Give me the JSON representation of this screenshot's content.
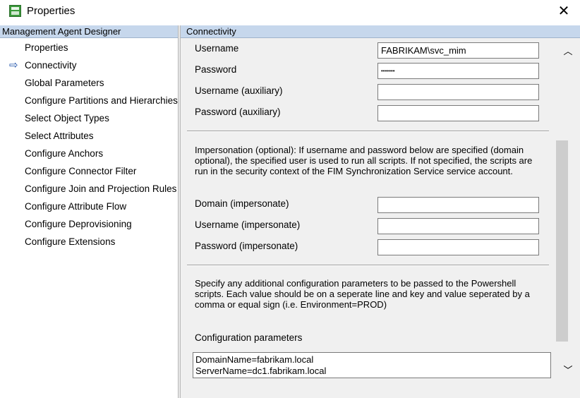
{
  "window": {
    "title": "Properties",
    "close_symbol": "✕"
  },
  "left_panel": {
    "header": "Management Agent Designer",
    "items": [
      {
        "label": "Properties",
        "selected": false
      },
      {
        "label": "Connectivity",
        "selected": true
      },
      {
        "label": "Global Parameters",
        "selected": false
      },
      {
        "label": "Configure Partitions and Hierarchies",
        "selected": false
      },
      {
        "label": "Select Object Types",
        "selected": false
      },
      {
        "label": "Select Attributes",
        "selected": false
      },
      {
        "label": "Configure Anchors",
        "selected": false
      },
      {
        "label": "Configure Connector Filter",
        "selected": false
      },
      {
        "label": "Configure Join and Projection Rules",
        "selected": false
      },
      {
        "label": "Configure Attribute Flow",
        "selected": false
      },
      {
        "label": "Configure Deprovisioning",
        "selected": false
      },
      {
        "label": "Configure Extensions",
        "selected": false
      }
    ],
    "current_arrow": "⇨"
  },
  "right_panel": {
    "header": "Connectivity",
    "fields": {
      "username": {
        "label": "Username",
        "value": "FABRIKAM\\svc_mim"
      },
      "password": {
        "label": "Password",
        "value": "•••••••"
      },
      "username_aux": {
        "label": "Username (auxiliary)",
        "value": ""
      },
      "password_aux": {
        "label": "Password (auxiliary)",
        "value": ""
      },
      "domain_imp": {
        "label": "Domain (impersonate)",
        "value": ""
      },
      "username_imp": {
        "label": "Username (impersonate)",
        "value": ""
      },
      "password_imp": {
        "label": "Password  (impersonate)",
        "value": ""
      }
    },
    "impersonation_text": "Impersonation (optional): If username and password below are specified (domain optional), the specified user is used to run all scripts. If not specified, the scripts are run in the security context of the FIM Synchronization Service service account.",
    "config_text": "Specify any additional configuration parameters to be passed to the Powershell scripts. Each value should be on a seperate line and key and value seperated by a comma or equal sign (i.e. Environment=PROD)",
    "config_label": "Configuration parameters",
    "config_lines": [
      "DomainName=fabrikam.local",
      "ServerName=dc1.fabrikam.local"
    ]
  },
  "scrollbar": {
    "up_symbol": "︿",
    "down_symbol": "﹀"
  }
}
